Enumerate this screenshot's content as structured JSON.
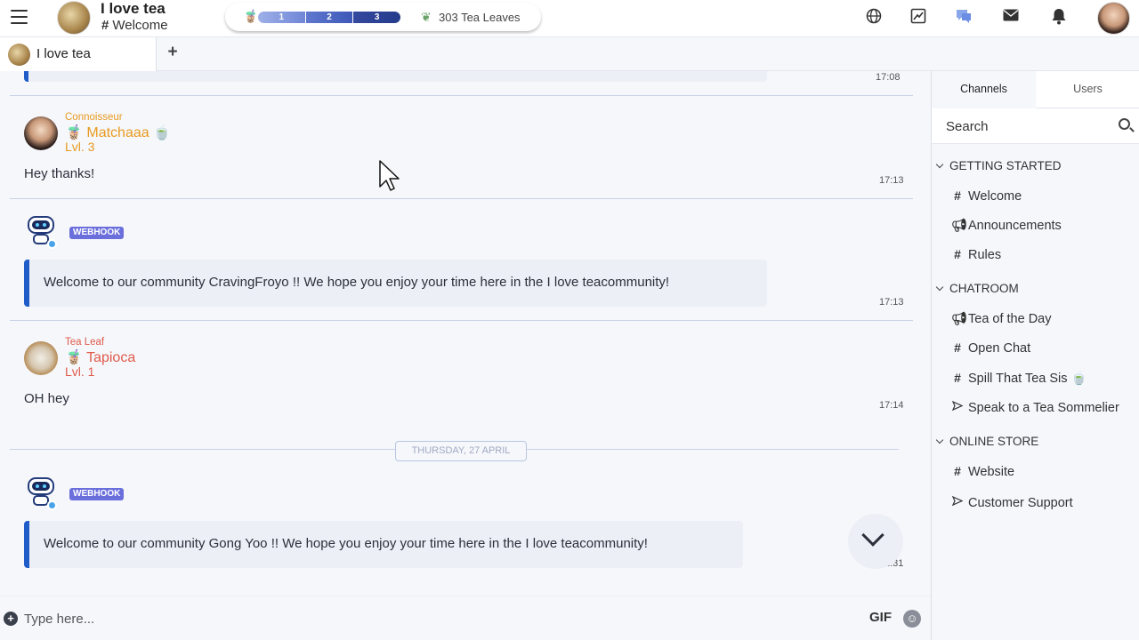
{
  "header": {
    "community_name": "I love tea",
    "channel_name": "Welcome",
    "levels": [
      "1",
      "2",
      "3"
    ],
    "leaves_text": "303 Tea Leaves"
  },
  "tabs": {
    "active_label": "I love tea",
    "add_symbol": "+"
  },
  "messages": [
    {
      "time": "17:08"
    },
    {
      "role": "Connoisseur",
      "username": "Matchaaa",
      "level": "Lvl. 3",
      "text": "Hey thanks!",
      "time": "17:13"
    },
    {
      "badge": "WEBHOOK",
      "text": "Welcome to our community CravingFroyo !! We hope you enjoy your time here in the I love teacommunity!",
      "time": "17:13"
    },
    {
      "role": "Tea Leaf",
      "username": "Tapioca",
      "level": "Lvl. 1",
      "text": "OH hey",
      "time": "17:14"
    },
    {
      "badge": "WEBHOOK",
      "text": "Welcome to our community Gong Yoo !! We hope you enjoy your time here in the I love teacommunity!",
      "time": "1:31"
    }
  ],
  "date_separator": "THURSDAY, 27 APRIL",
  "composer": {
    "placeholder": "Type here...",
    "gif_label": "GIF"
  },
  "sidebar": {
    "tabs": [
      "Channels",
      "Users"
    ],
    "search_placeholder": "Search",
    "groups": [
      {
        "title": "GETTING STARTED",
        "items": [
          {
            "icon": "hash",
            "label": "Welcome"
          },
          {
            "icon": "megaphone",
            "label": "Announcements"
          },
          {
            "icon": "hash",
            "label": "Rules"
          }
        ]
      },
      {
        "title": "CHATROOM",
        "items": [
          {
            "icon": "megaphone",
            "label": "Tea of the Day"
          },
          {
            "icon": "hash",
            "label": "Open Chat"
          },
          {
            "icon": "hash",
            "label": "Spill That Tea Sis 🍵"
          },
          {
            "icon": "send",
            "label": "Speak to a Tea Sommelier"
          }
        ]
      },
      {
        "title": "ONLINE STORE",
        "items": [
          {
            "icon": "hash",
            "label": "Website"
          },
          {
            "icon": "send",
            "label": "Customer Support"
          }
        ]
      }
    ]
  },
  "colors": {
    "accent_blue": "#1f5cc8",
    "role_orange": "#e99a1f",
    "role_red": "#e05a4b",
    "webhook_badge": "#6b6fdc"
  }
}
